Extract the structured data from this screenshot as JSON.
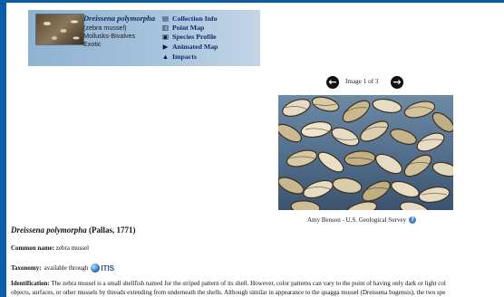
{
  "header": {
    "species_name": "Dreissena polymorpha",
    "common_name": "(zebra mussel)",
    "group": "Mollusks-Bivalves",
    "status": "Exotic",
    "links": [
      {
        "label": "Collection Info",
        "icon": "table-icon"
      },
      {
        "label": "Point Map",
        "icon": "map-icon"
      },
      {
        "label": "Species Profile",
        "icon": "profile-icon"
      },
      {
        "label": "Animated Map",
        "icon": "play-icon"
      },
      {
        "label": "Impacts",
        "icon": "warning-icon"
      }
    ]
  },
  "gallery": {
    "counter": "Image 1 of 3",
    "credit": "Amy Benson - U.S. Geological Survey"
  },
  "profile": {
    "title_italic": "Dreissena polymorpha",
    "title_author": "(Pallas, 1771)",
    "common_label": "Common name:",
    "common_value": "zebra mussel",
    "taxonomy_label": "Taxonomy:",
    "taxonomy_value": "available through",
    "itis_text": "ITIS",
    "ident_label": "Identification:",
    "ident_line1": "The zebra mussel is a small shellfish named for the striped pattern of its shell. However, color patterns can vary to the point of having only dark or light col",
    "ident_line2": "objects, surfaces, or other mussels by threads extending from underneath the shells. Although similar in appearance to the quagga mussel (Dreissena bugensis), the two spe"
  },
  "colors": {
    "page_frame": "#0b5cab",
    "banner": "#a6c2dc",
    "link_text": "#0d2a6a"
  }
}
